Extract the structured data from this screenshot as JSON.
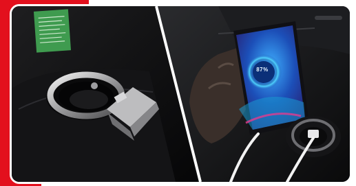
{
  "scene": {
    "description_panels": [
      "cup-holder",
      "phone-charging"
    ],
    "phone": {
      "charge_text": "87%"
    },
    "colors": {
      "accent_red": "#e3101d",
      "frame_white": "#ffffff",
      "sticker_green": "#3f9b4f",
      "phone_blue": "#2f7fd6"
    }
  }
}
